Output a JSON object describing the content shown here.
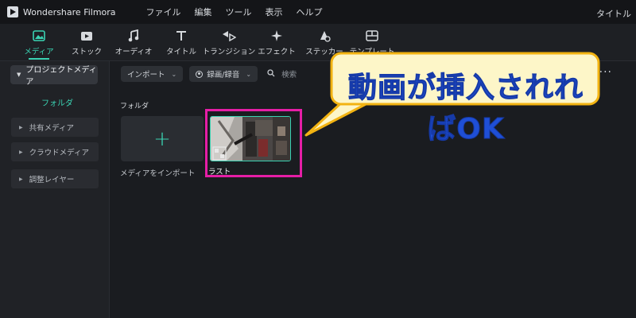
{
  "app": {
    "name": "Wondershare Filmora",
    "title_right": "タイトル"
  },
  "menu": [
    "ファイル",
    "編集",
    "ツール",
    "表示",
    "ヘルプ"
  ],
  "toolbar": {
    "tabs": [
      {
        "label": "メディア",
        "icon": "media-icon",
        "active": true
      },
      {
        "label": "ストック",
        "icon": "stock-icon"
      },
      {
        "label": "オーディオ",
        "icon": "music-note-icon"
      },
      {
        "label": "タイトル",
        "icon": "title-t-icon"
      },
      {
        "label": "トランジション",
        "icon": "transition-icon"
      },
      {
        "label": "エフェクト",
        "icon": "effect-sparkle-icon"
      },
      {
        "label": "ステッカー",
        "icon": "sticker-icon"
      },
      {
        "label": "テンプレート",
        "icon": "template-icon"
      }
    ]
  },
  "sidebar": {
    "project_media": "プロジェクトメディア",
    "folder": "フォルダ",
    "items": [
      "共有メディア",
      "クラウドメディア",
      "調整レイヤー"
    ]
  },
  "filters": {
    "import_dropdown": "インポート",
    "record_dropdown": "録画/録音",
    "search_placeholder": "検索"
  },
  "content": {
    "folder_heading": "フォルダ",
    "import_card_label": "メディアをインポート",
    "clip_label": "ラスト"
  },
  "callout": {
    "text": "動画が挿入されればOK"
  },
  "colors": {
    "accent": "#3ad2b2",
    "highlight": "#e51ea6",
    "callout_fill": "#fdf6c8",
    "callout_border": "#f2b312",
    "callout_text": "#1f4fd6"
  }
}
